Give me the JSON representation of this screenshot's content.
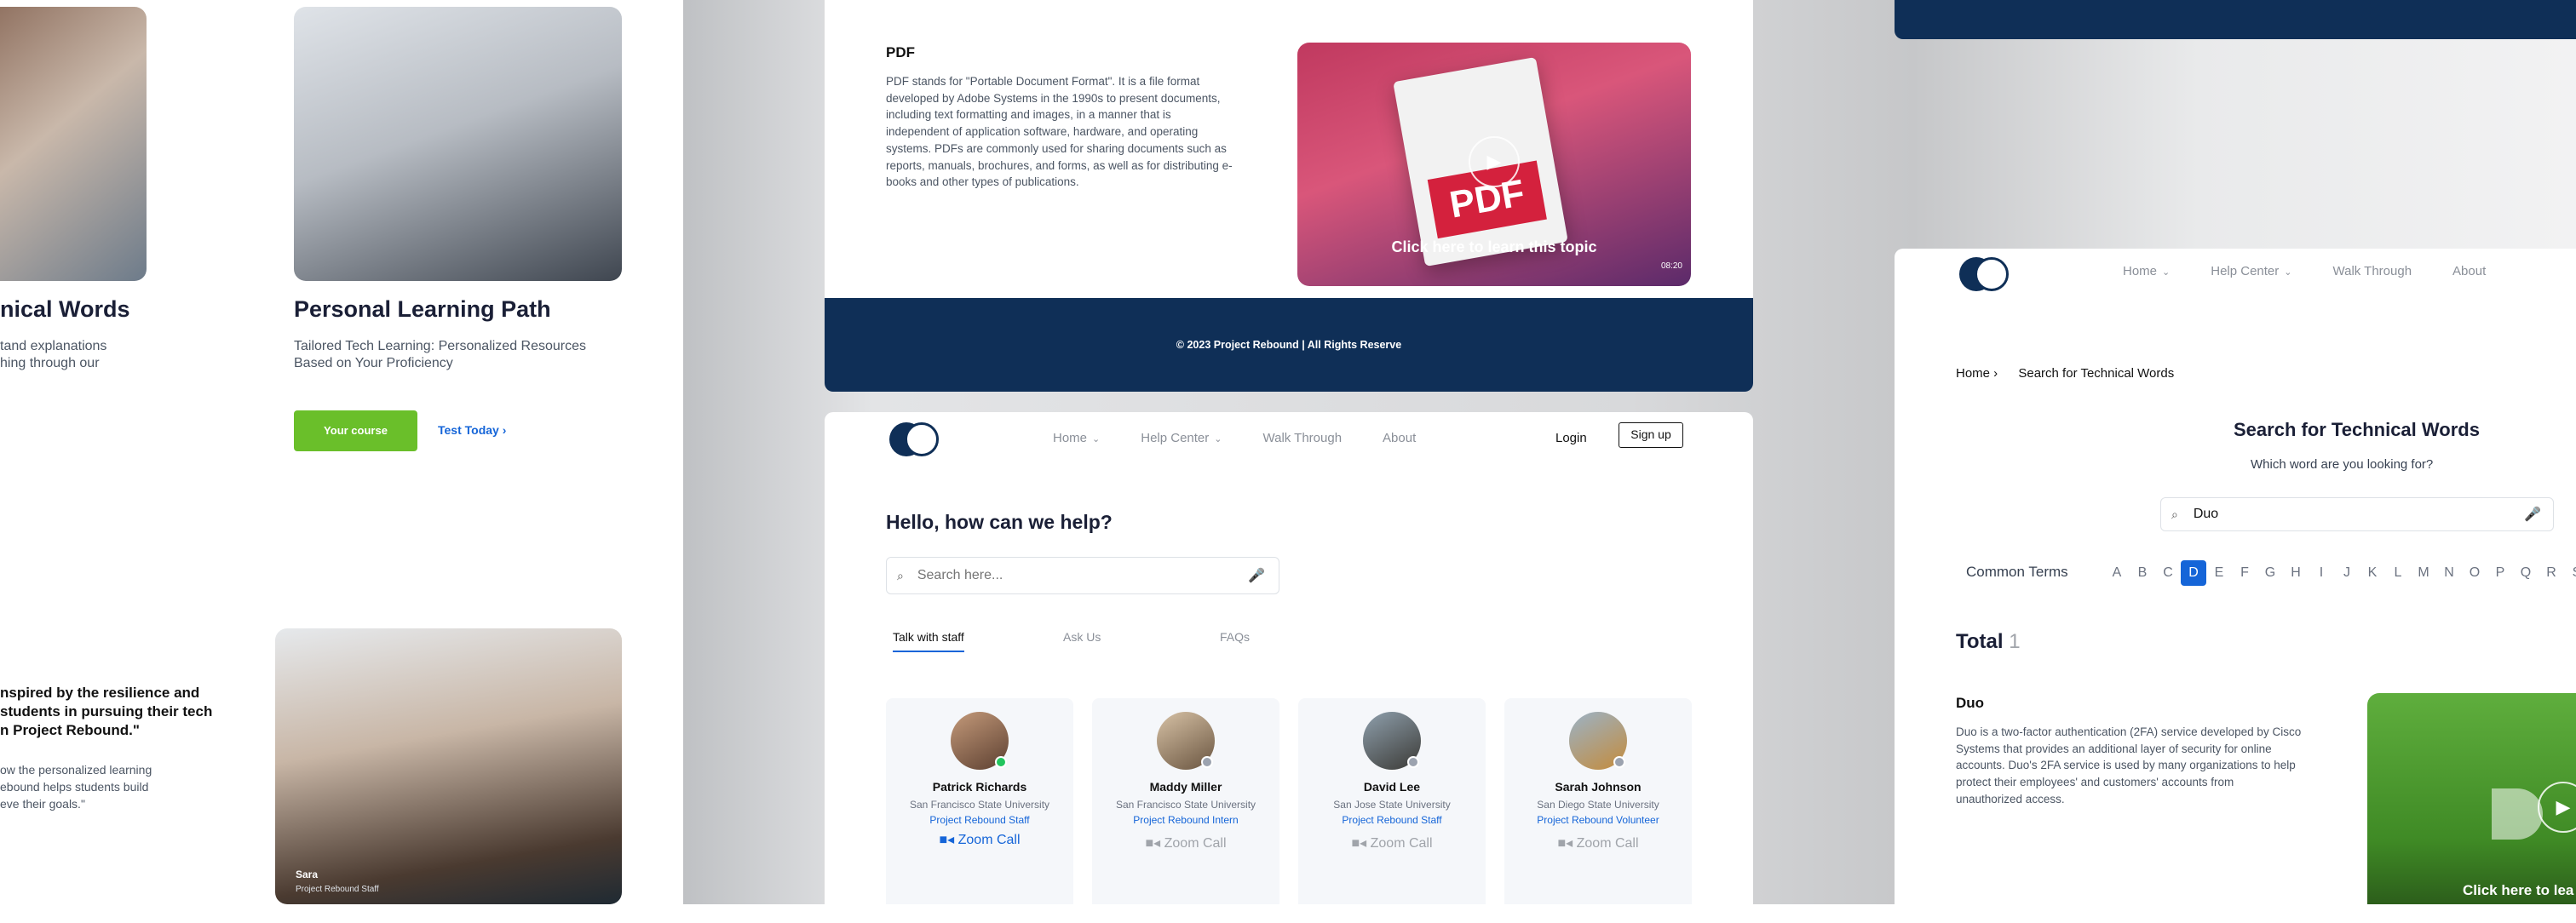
{
  "panel1": {
    "heading_left": "nical Words",
    "desc_left": [
      "tand explanations",
      "hing through our"
    ],
    "heading": "Personal Learning Path",
    "desc": [
      "Tailored Tech Learning: Personalized Resources",
      "Based on Your Proficiency"
    ],
    "btn_course": "Your course",
    "btn_test": "Test Today ›",
    "quote": [
      "nspired by the resilience and",
      "students in pursuing their tech",
      "n Project Rebound.\""
    ],
    "quote_sub": [
      "ow the personalized learning",
      "ebound helps students build",
      "eve their goals.\""
    ],
    "sara_name": "Sara",
    "sara_role": "Project Rebound Staff"
  },
  "panel2": {
    "pdf_title": "PDF",
    "pdf_desc": [
      "PDF stands for \"Portable Document Format\". It is a file format",
      "developed by Adobe Systems in the 1990s to present documents,",
      "including text formatting and images, in a manner that is",
      "independent of application software, hardware, and operating",
      "systems. PDFs are commonly used for sharing documents such as",
      "reports, manuals, brochures, and forms, as well as for distributing e-",
      "books and other types of publications."
    ],
    "thumb_label": "PDF",
    "thumb_cta": "Click here to learn this topic",
    "thumb_duration": "08:20",
    "footer": "© 2023 Project Rebound | All Rights Reserve"
  },
  "panel3": {
    "nav": [
      "Home",
      "Help Center",
      "Walk Through",
      "About"
    ],
    "login": "Login",
    "signup": "Sign up",
    "hello": "Hello, how can we help?",
    "search_placeholder": "Search here...",
    "tabs": [
      "Talk with staff",
      "Ask Us",
      "FAQs"
    ],
    "staff": [
      {
        "name": "Patrick Richards",
        "school": "San Francisco State University",
        "role": "Project Rebound Staff",
        "call": "Zoom Call",
        "online": true,
        "color": "#1565d8"
      },
      {
        "name": "Maddy Miller",
        "school": "San Francisco State University",
        "role": "Project Rebound Intern",
        "call": "Zoom Call",
        "online": false,
        "color": "#a0a4aa"
      },
      {
        "name": "David Lee",
        "school": "San Jose State University",
        "role": "Project Rebound Staff",
        "call": "Zoom Call",
        "online": false,
        "color": "#a0a4aa"
      },
      {
        "name": "Sarah Johnson",
        "school": "San Diego State University",
        "role": "Project Rebound Volunteer",
        "call": "Zoom Call",
        "online": false,
        "color": "#a0a4aa"
      }
    ]
  },
  "panel4": {
    "nav": [
      "Home",
      "Help Center",
      "Walk Through",
      "About"
    ],
    "breadcrumb_home": "Home ›",
    "breadcrumb_current": "Search for Technical Words",
    "title": "Search for Technical Words",
    "subtitle": "Which word are you looking for?",
    "search_value": "Duo",
    "common_terms": "Common Terms",
    "letters": [
      "A",
      "B",
      "C",
      "D",
      "E",
      "F",
      "G",
      "H",
      "I",
      "J",
      "K",
      "L",
      "M",
      "N",
      "O",
      "P",
      "Q",
      "R",
      "S"
    ],
    "active_letter": "D",
    "total_label": "Total",
    "total_count": "1",
    "term": "Duo",
    "term_desc": [
      "Duo is a two-factor authentication (2FA) service developed by Cisco",
      "Systems that provides an additional layer of security for online",
      "accounts. Duo's 2FA service is used by many organizations to help",
      "protect their employees' and customers' accounts from",
      "unauthorized access."
    ],
    "thumb_cta": "Click here to lea"
  },
  "colors": {
    "navy": "#0f2f57",
    "green": "#6abf2a",
    "blue": "#1565d8"
  }
}
